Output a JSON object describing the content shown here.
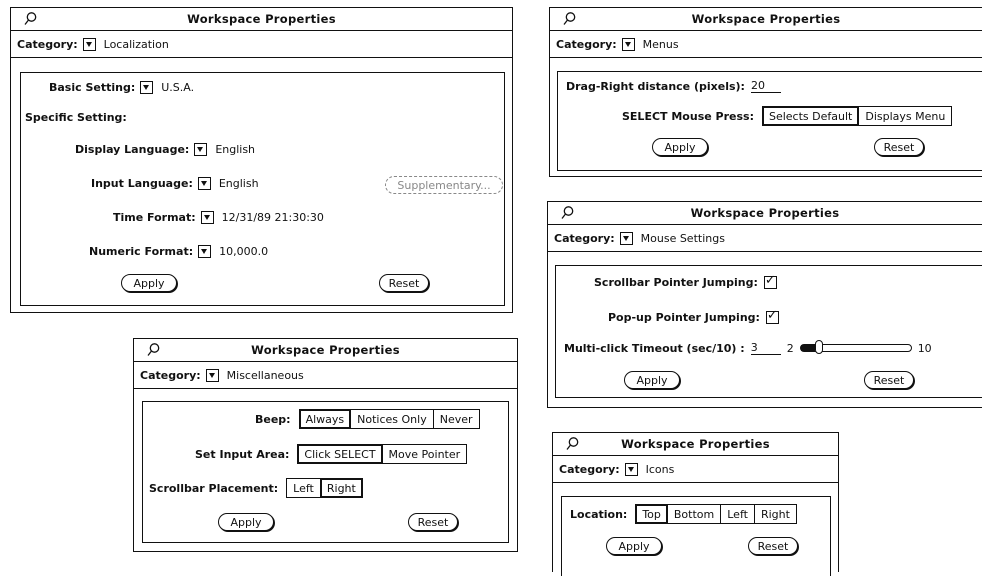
{
  "window_title": "Workspace Properties",
  "category_label": "Category:",
  "apply_label": "Apply",
  "reset_label": "Reset",
  "localization": {
    "category": "Localization",
    "basic_setting_label": "Basic Setting:",
    "basic_setting_value": "U.S.A.",
    "specific_setting_label": "Specific Setting:",
    "display_language_label": "Display Language:",
    "display_language_value": "English",
    "input_language_label": "Input Language:",
    "input_language_value": "English",
    "supplementary_label": "Supplementary...",
    "time_format_label": "Time Format:",
    "time_format_value": "12/31/89 21:30:30",
    "numeric_format_label": "Numeric Format:",
    "numeric_format_value": "10,000.0"
  },
  "menus": {
    "category": "Menus",
    "drag_right_label": "Drag-Right distance (pixels):",
    "drag_right_value": "20",
    "select_mouse_label": "SELECT Mouse Press:",
    "select_options": [
      "Selects Default",
      "Displays Menu"
    ],
    "selected_option": "Selects Default"
  },
  "mouse": {
    "category": "Mouse Settings",
    "scrollbar_jump_label": "Scrollbar Pointer Jumping:",
    "scrollbar_jump_checked": true,
    "popup_jump_label": "Pop-up Pointer Jumping:",
    "popup_jump_checked": true,
    "multiclick_label": "Multi-click Timeout (sec/10) :",
    "multiclick_value": "3",
    "slider_min": "2",
    "slider_max": "10",
    "slider_level": 0.125
  },
  "misc": {
    "category": "Miscellaneous",
    "beep_label": "Beep:",
    "beep_options": [
      "Always",
      "Notices Only",
      "Never"
    ],
    "beep_selected": "Always",
    "input_area_label": "Set Input Area:",
    "input_area_options": [
      "Click SELECT",
      "Move Pointer"
    ],
    "input_area_selected": "Click SELECT",
    "scrollbar_placement_label": "Scrollbar Placement:",
    "scrollbar_options": [
      "Left",
      "Right"
    ],
    "scrollbar_selected": "Right"
  },
  "icons": {
    "category": "Icons",
    "location_label": "Location:",
    "location_options": [
      "Top",
      "Bottom",
      "Left",
      "Right"
    ],
    "location_selected": "Top"
  }
}
